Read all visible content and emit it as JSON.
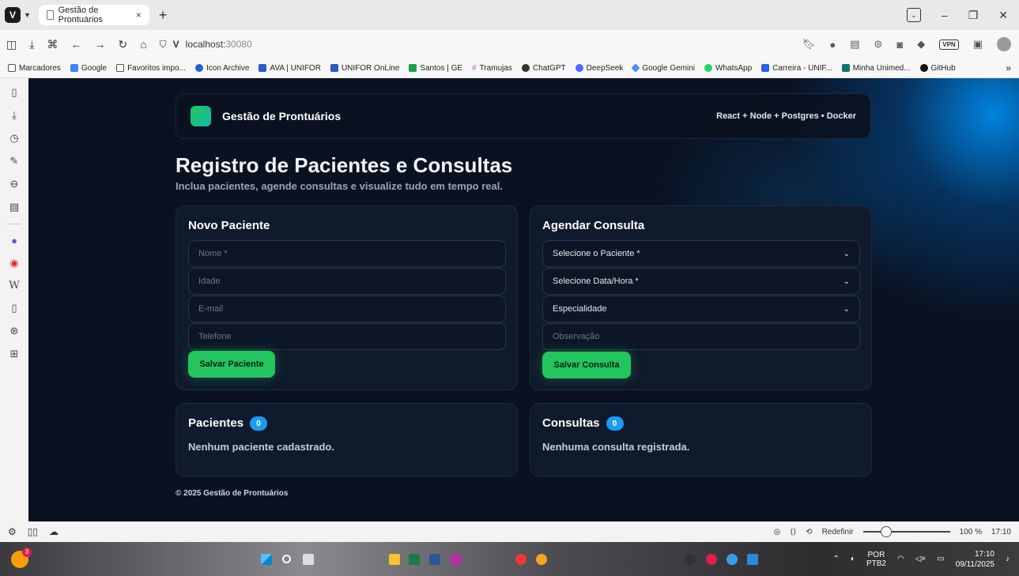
{
  "browser": {
    "tab_title": "Gestão de Prontuários",
    "url_host": "localhost:",
    "url_port": "30080",
    "vpn_label": "VPN"
  },
  "bookmarks": [
    {
      "label": "Marcadores",
      "color": "#555555"
    },
    {
      "label": "Google",
      "color": "#4285f4"
    },
    {
      "label": "Favoritos impo...",
      "color": "#555555"
    },
    {
      "label": "Icon Archive",
      "color": "#1e66d0"
    },
    {
      "label": "AVA | UNIFOR",
      "color": "#2b5cc4"
    },
    {
      "label": "UNIFOR OnLine",
      "color": "#2b5cc4"
    },
    {
      "label": "Santos | GE",
      "color": "#19a34a"
    },
    {
      "label": "Tramujas",
      "color": "#d15ad1"
    },
    {
      "label": "ChatGPT",
      "color": "#333333"
    },
    {
      "label": "DeepSeek",
      "color": "#4d6bfe"
    },
    {
      "label": "Google Gemini",
      "color": "#4f8df7"
    },
    {
      "label": "WhatsApp",
      "color": "#25d366"
    },
    {
      "label": "Carreira - UNIF...",
      "color": "#2563eb"
    },
    {
      "label": "Minha Unimed...",
      "color": "#0f766e"
    },
    {
      "label": "GitHub",
      "color": "#111111"
    }
  ],
  "header": {
    "brand": "Gestão de Prontuários",
    "stack": "React + Node + Postgres • Docker"
  },
  "page": {
    "title": "Registro de Pacientes e Consultas",
    "subtitle": "Inclua pacientes, agende consultas e visualize tudo em tempo real."
  },
  "novo_paciente": {
    "title": "Novo Paciente",
    "nome_placeholder": "Nome *",
    "idade_placeholder": "Idade",
    "email_placeholder": "E-mail",
    "telefone_placeholder": "Telefone",
    "save_label": "Salvar Paciente"
  },
  "agendar_consulta": {
    "title": "Agendar Consulta",
    "paciente_select": "Selecione o Paciente *",
    "datahora_select": "Selecione Data/Hora *",
    "especialidade_select": "Especialidade",
    "observacao_placeholder": "Observação",
    "save_label": "Salvar Consulta"
  },
  "pacientes": {
    "title": "Pacientes",
    "count": "0",
    "empty": "Nenhum paciente cadastrado."
  },
  "consultas": {
    "title": "Consultas",
    "count": "0",
    "empty": "Nenhuma consulta registrada."
  },
  "footer": "© 2025 Gestão de Prontuários",
  "statusbar": {
    "reset": "Redefinir",
    "zoom": "100 %",
    "time": "17:10"
  },
  "taskbar": {
    "lang": "POR",
    "layout": "PTB2",
    "time": "17:10",
    "date": "09/11/2025",
    "badge": "3"
  },
  "colors": {
    "accent_green": "#22c55e",
    "badge_blue": "#1d9bf0",
    "page_bg": "#0a1222"
  }
}
